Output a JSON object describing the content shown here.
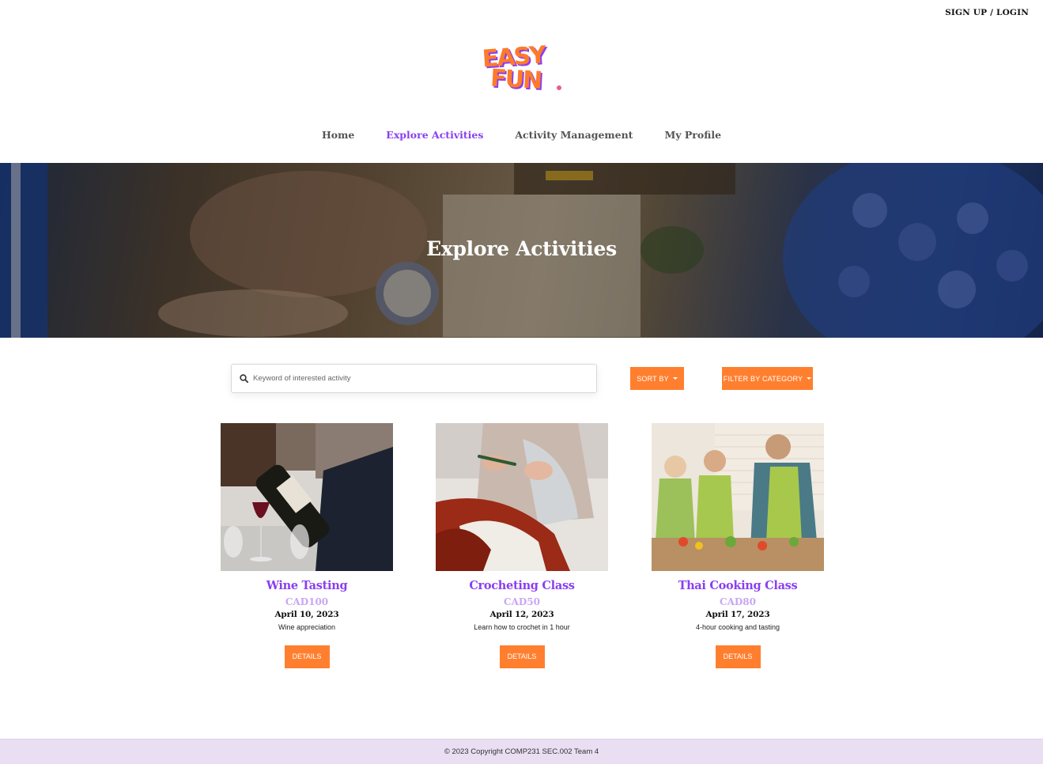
{
  "header": {
    "login_label": "SIGN UP / LOGIN",
    "logo_text_line1": "EASY",
    "logo_text_line2": "FUN"
  },
  "nav": {
    "items": [
      {
        "label": "Home",
        "active": false
      },
      {
        "label": "Explore Activities",
        "active": true
      },
      {
        "label": "Activity Management",
        "active": false
      },
      {
        "label": "My Profile",
        "active": false
      }
    ]
  },
  "hero": {
    "title": "Explore Activities"
  },
  "toolbar": {
    "search_placeholder": "Keyword of interested activity",
    "sort_label": "SORT BY",
    "filter_label": "FILTER BY CATEGORY"
  },
  "activities": [
    {
      "title": "Wine Tasting",
      "price": "CAD100",
      "date": "April 10, 2023",
      "description": "Wine appreciation",
      "button": "DETAILS"
    },
    {
      "title": "Crocheting Class",
      "price": "CAD50",
      "date": "April 12, 2023",
      "description": "Learn how to crochet in 1 hour",
      "button": "DETAILS"
    },
    {
      "title": "Thai Cooking Class",
      "price": "CAD80",
      "date": "April 17, 2023",
      "description": "4-hour cooking and tasting",
      "button": "DETAILS"
    }
  ],
  "footer": {
    "copyright": "© 2023 Copyright COMP231 SEC.002 Team 4"
  },
  "colors": {
    "accent_purple": "#8a3ff0",
    "price_lavender": "#c9a6f3",
    "button_orange": "#ff7f2f",
    "footer_bg": "#e9def2",
    "logo_orange": "#ff7a2a",
    "logo_purple": "#8a3ff0"
  }
}
